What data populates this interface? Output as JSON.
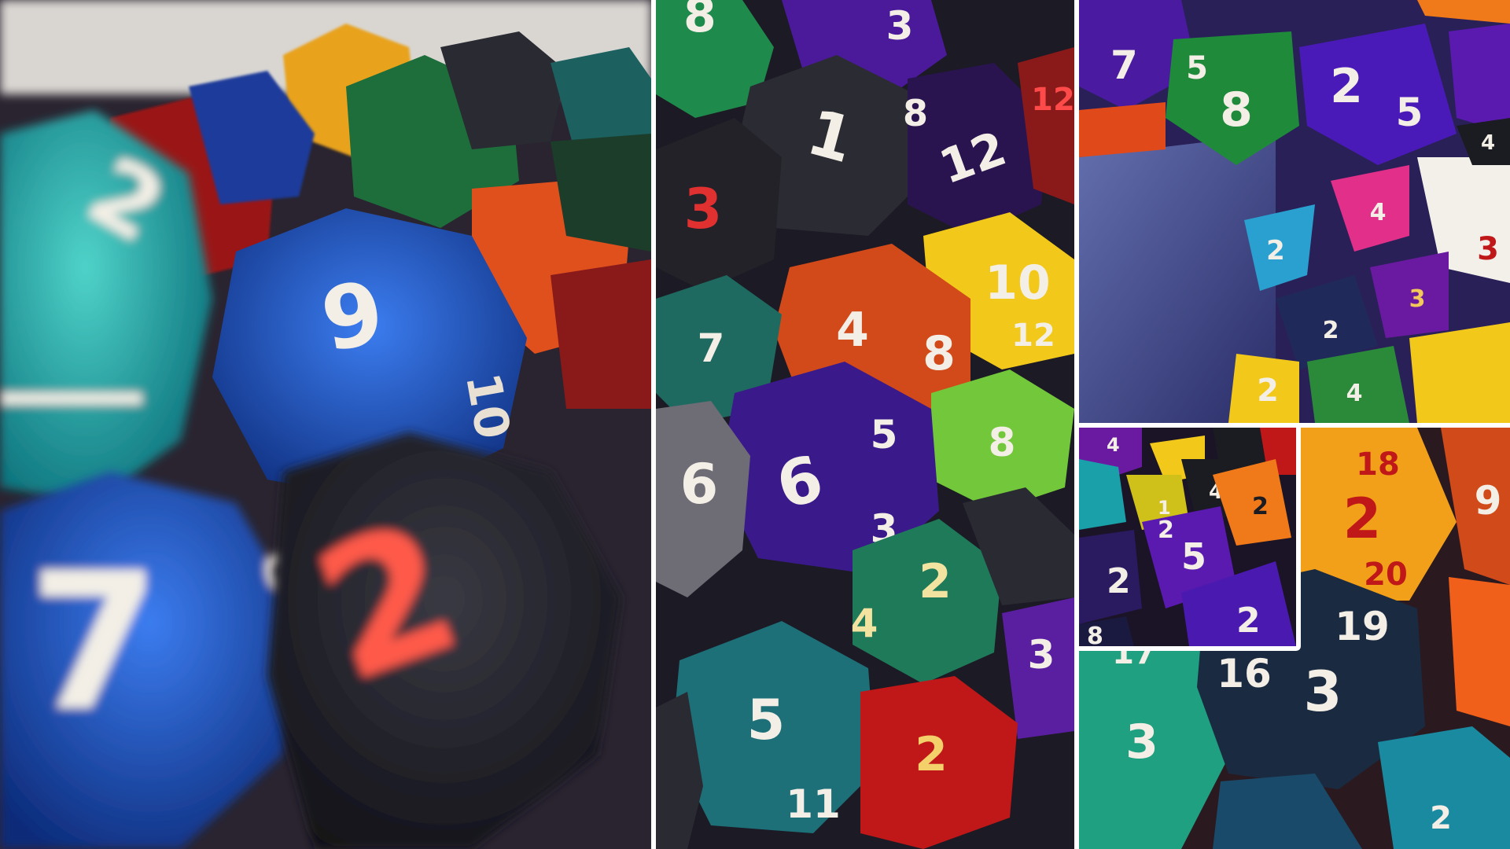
{
  "image": {
    "kind": "photo-collage",
    "subject": "pile-of-polyhedral-dice",
    "panels": [
      {
        "id": "left",
        "content": "closeup-d12-dice-blurred-foreground"
      },
      {
        "id": "center",
        "content": "d12-dice-pile"
      },
      {
        "id": "top-right",
        "content": "d4-and-d8-dice-in-bin"
      },
      {
        "id": "inset",
        "content": "d4-dice-purple-closeup"
      },
      {
        "id": "bottom-right",
        "content": "d20-dice-closeup"
      }
    ]
  },
  "colors": {
    "divider": "#ffffff",
    "teal": "#1aa7a8",
    "blue": "#1f4fb0",
    "green": "#1d7a3a",
    "orange": "#e4561f",
    "red": "#b01818",
    "purple": "#4b1a9a",
    "yellow": "#f2c21a",
    "black": "#1b1b22",
    "die_number": "#f3efe6"
  }
}
